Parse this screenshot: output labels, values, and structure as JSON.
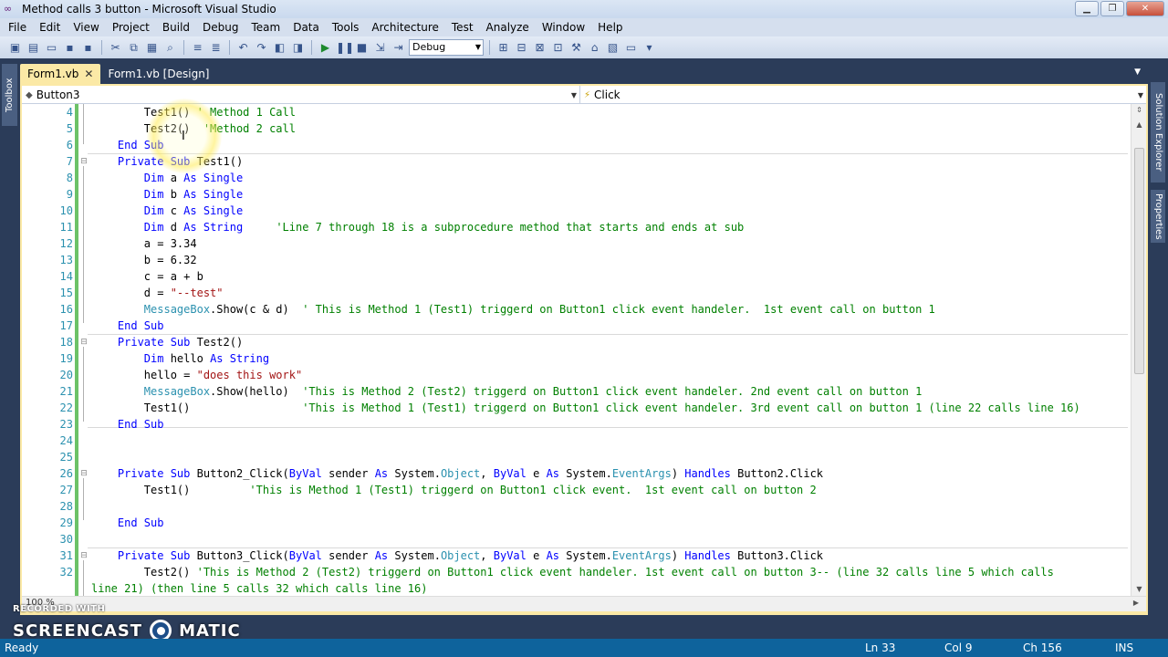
{
  "window": {
    "title": "Method calls 3 button - Microsoft Visual Studio"
  },
  "menu": [
    "File",
    "Edit",
    "View",
    "Project",
    "Build",
    "Debug",
    "Team",
    "Data",
    "Tools",
    "Architecture",
    "Test",
    "Analyze",
    "Window",
    "Help"
  ],
  "toolbar": {
    "config_value": "Debug"
  },
  "left_panel": {
    "toolbox_label": "Toolbox"
  },
  "right_panel": {
    "solution_explorer_label": "Solution Explorer",
    "properties_label": "Properties"
  },
  "tabs": [
    {
      "label": "Form1.vb",
      "active": true
    },
    {
      "label": "Form1.vb [Design]",
      "active": false
    }
  ],
  "nav": {
    "object": "Button3",
    "event": "Click"
  },
  "code": {
    "line_numbers": [
      "4",
      "5",
      "6",
      "7",
      "8",
      "9",
      "10",
      "11",
      "12",
      "13",
      "14",
      "15",
      "16",
      "17",
      "18",
      "19",
      "20",
      "21",
      "22",
      "23",
      "24",
      "25",
      "26",
      "27",
      "28",
      "29",
      "30",
      "31",
      "32"
    ],
    "wrapped_line": "line 21) (then line 5 calls 32 which calls line 16)"
  },
  "editor": {
    "zoom": "100 %"
  },
  "status": {
    "ready": "Ready",
    "ln": "Ln 33",
    "col": "Col 9",
    "ch": "Ch 156",
    "ins": "INS"
  },
  "watermark": {
    "recorded_with": "RECORDED WITH",
    "brand_left": "SCREENCAST",
    "brand_right": "MATIC"
  }
}
